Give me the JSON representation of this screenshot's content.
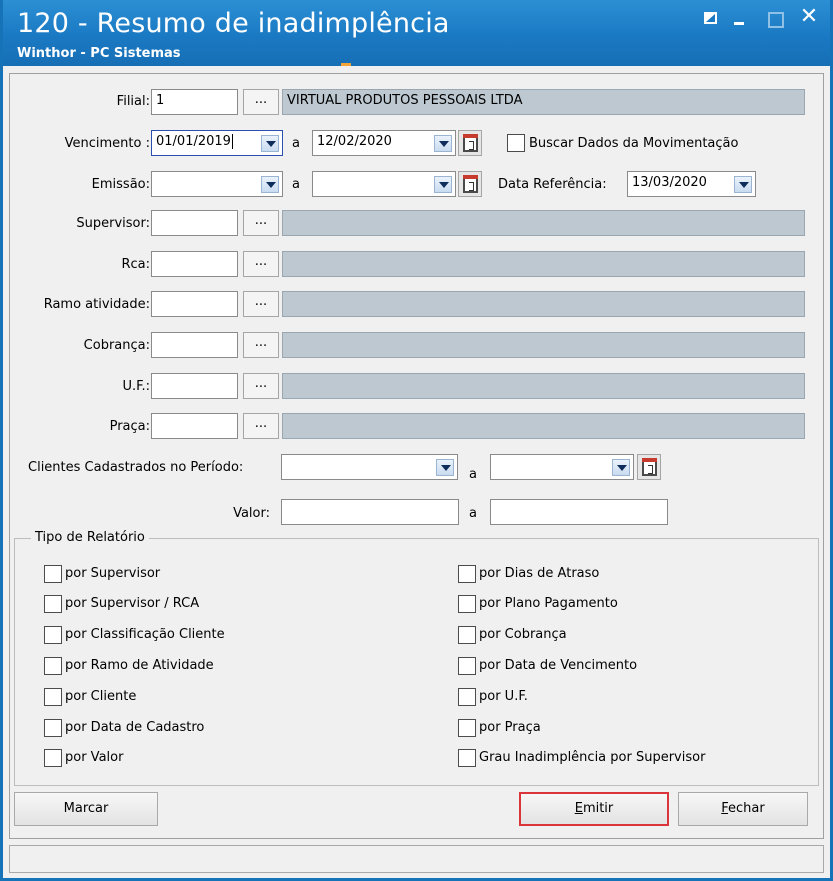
{
  "window": {
    "title": "120 - Resumo de inadimplência",
    "subtitle": "Winthor - PC Sistemas",
    "close_glyph": "✕"
  },
  "filters": {
    "filial": {
      "label": "Filial:",
      "code": "1",
      "description": "VIRTUAL PRODUTOS PESSOAIS LTDA"
    },
    "vencimento": {
      "label": "Vencimento :",
      "from": "01/01/2019",
      "sep": "a",
      "to": "12/02/2020"
    },
    "buscar_movimentacao": {
      "label": "Buscar Dados da Movimentação",
      "checked": false
    },
    "emissao": {
      "label": "Emissão:",
      "from": "",
      "sep": "a",
      "to": ""
    },
    "data_referencia": {
      "label": "Data Referência:",
      "value": "13/03/2020"
    },
    "supervisor": {
      "label": "Supervisor:",
      "code": "",
      "description": ""
    },
    "rca": {
      "label": "Rca:",
      "code": "",
      "description": ""
    },
    "ramo_atividade": {
      "label": "Ramo atividade:",
      "code": "",
      "description": ""
    },
    "cobranca": {
      "label": "Cobrança:",
      "code": "",
      "description": ""
    },
    "uf": {
      "label": "U.F.:",
      "code": "",
      "description": ""
    },
    "praca": {
      "label": "Praça:",
      "code": "",
      "description": ""
    },
    "clientes_periodo": {
      "label": "Clientes Cadastrados no Período:",
      "from": "",
      "sep": "a",
      "to": ""
    },
    "valor": {
      "label": "Valor:",
      "from": "",
      "sep": "a",
      "to": ""
    },
    "dots_label": "..."
  },
  "report_type": {
    "legend": "Tipo de Relatório",
    "left": [
      {
        "label": "por Supervisor",
        "checked": false
      },
      {
        "label": "por Supervisor / RCA",
        "checked": false
      },
      {
        "label": "por Classificação Cliente",
        "checked": false
      },
      {
        "label": "por Ramo de Atividade",
        "checked": false
      },
      {
        "label": "por Cliente",
        "checked": false
      },
      {
        "label": "por Data de Cadastro",
        "checked": false
      },
      {
        "label": "por Valor",
        "checked": false
      }
    ],
    "right": [
      {
        "label": "por Dias de Atraso",
        "checked": false
      },
      {
        "label": "por Plano Pagamento",
        "checked": false
      },
      {
        "label": "por Cobrança",
        "checked": false
      },
      {
        "label": "por Data de Vencimento",
        "checked": false
      },
      {
        "label": "por U.F.",
        "checked": false
      },
      {
        "label": "por Praça",
        "checked": false
      },
      {
        "label": "Grau Inadimplência por Supervisor",
        "checked": false
      }
    ]
  },
  "buttons": {
    "marcar": "Marcar",
    "emitir_first": "E",
    "emitir_rest": "mitir",
    "fechar_first": "F",
    "fechar_rest": "echar"
  },
  "statusbar": {
    "text": ""
  }
}
